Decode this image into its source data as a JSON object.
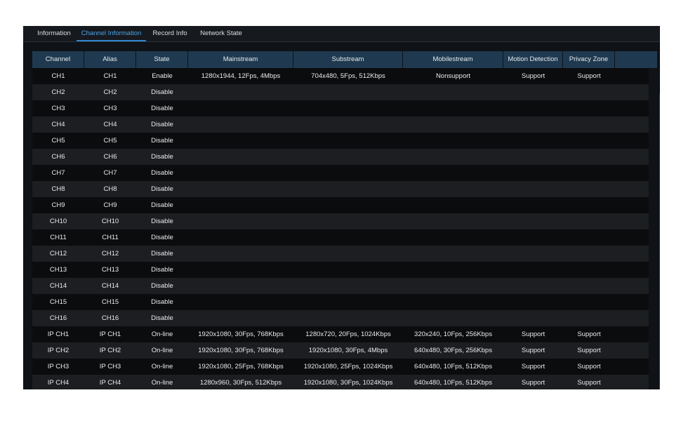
{
  "tabs": [
    {
      "label": "Information",
      "active": false
    },
    {
      "label": "Channel Information",
      "active": true
    },
    {
      "label": "Record Info",
      "active": false
    },
    {
      "label": "Network State",
      "active": false
    }
  ],
  "columns": [
    "Channel",
    "Alias",
    "State",
    "Mainstream",
    "Substream",
    "Mobilestream",
    "Motion Detection",
    "Privacy Zone"
  ],
  "rows": [
    [
      "CH1",
      "CH1",
      "Enable",
      "1280x1944, 12Fps, 4Mbps",
      "704x480, 5Fps, 512Kbps",
      "Nonsupport",
      "Support",
      "Support"
    ],
    [
      "CH2",
      "CH2",
      "Disable",
      "",
      "",
      "",
      "",
      ""
    ],
    [
      "CH3",
      "CH3",
      "Disable",
      "",
      "",
      "",
      "",
      ""
    ],
    [
      "CH4",
      "CH4",
      "Disable",
      "",
      "",
      "",
      "",
      ""
    ],
    [
      "CH5",
      "CH5",
      "Disable",
      "",
      "",
      "",
      "",
      ""
    ],
    [
      "CH6",
      "CH6",
      "Disable",
      "",
      "",
      "",
      "",
      ""
    ],
    [
      "CH7",
      "CH7",
      "Disable",
      "",
      "",
      "",
      "",
      ""
    ],
    [
      "CH8",
      "CH8",
      "Disable",
      "",
      "",
      "",
      "",
      ""
    ],
    [
      "CH9",
      "CH9",
      "Disable",
      "",
      "",
      "",
      "",
      ""
    ],
    [
      "CH10",
      "CH10",
      "Disable",
      "",
      "",
      "",
      "",
      ""
    ],
    [
      "CH11",
      "CH11",
      "Disable",
      "",
      "",
      "",
      "",
      ""
    ],
    [
      "CH12",
      "CH12",
      "Disable",
      "",
      "",
      "",
      "",
      ""
    ],
    [
      "CH13",
      "CH13",
      "Disable",
      "",
      "",
      "",
      "",
      ""
    ],
    [
      "CH14",
      "CH14",
      "Disable",
      "",
      "",
      "",
      "",
      ""
    ],
    [
      "CH15",
      "CH15",
      "Disable",
      "",
      "",
      "",
      "",
      ""
    ],
    [
      "CH16",
      "CH16",
      "Disable",
      "",
      "",
      "",
      "",
      ""
    ],
    [
      "IP CH1",
      "IP CH1",
      "On-line",
      "1920x1080, 30Fps, 768Kbps",
      "1280x720, 20Fps, 1024Kbps",
      "320x240, 10Fps, 256Kbps",
      "Support",
      "Support"
    ],
    [
      "IP CH2",
      "IP CH2",
      "On-line",
      "1920x1080, 30Fps, 768Kbps",
      "1920x1080, 30Fps, 4Mbps",
      "640x480, 30Fps, 256Kbps",
      "Support",
      "Support"
    ],
    [
      "IP CH3",
      "IP CH3",
      "On-line",
      "1920x1080, 25Fps, 768Kbps",
      "1920x1080, 25Fps, 1024Kbps",
      "640x480, 10Fps, 512Kbps",
      "Support",
      "Support"
    ],
    [
      "IP CH4",
      "IP CH4",
      "On-line",
      "1280x960, 30Fps, 512Kbps",
      "1920x1080, 30Fps, 1024Kbps",
      "640x480, 10Fps, 512Kbps",
      "Support",
      "Support"
    ]
  ],
  "colors": {
    "accent": "#2f86d0",
    "header_bg": "#1f3a50",
    "row_dark": "#0b0c0e",
    "row_light": "#1c1e21"
  }
}
